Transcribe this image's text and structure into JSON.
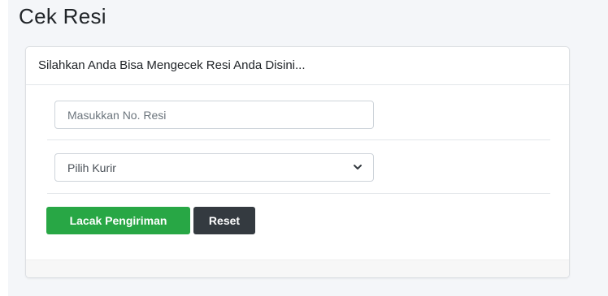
{
  "page": {
    "title": "Cek Resi"
  },
  "card": {
    "header": "Silahkan Anda Bisa Mengecek Resi Anda Disini...",
    "resi_input": {
      "placeholder": "Masukkan No. Resi",
      "value": ""
    },
    "courier_select": {
      "selected": "Pilih Kurir"
    },
    "buttons": {
      "track_label": "Lacak Pengiriman",
      "reset_label": "Reset"
    }
  },
  "colors": {
    "track_button": "#28a745",
    "reset_button": "#343a40",
    "page_background": "#f4f6f9"
  },
  "icons": {
    "select_arrow": "chevron-down-icon"
  }
}
